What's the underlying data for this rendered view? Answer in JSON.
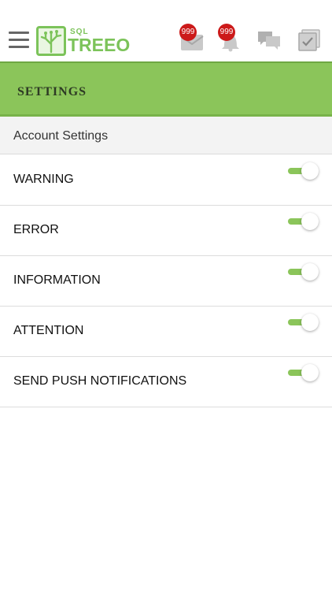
{
  "topbar": {
    "logo": {
      "prefix": "SQL",
      "word": "TREEO"
    },
    "messages_badge": "999",
    "notifications_badge": "999"
  },
  "header": {
    "title": "SETTINGS"
  },
  "section": {
    "title": "Account Settings"
  },
  "settings": [
    {
      "label": "WARNING",
      "enabled": true
    },
    {
      "label": "ERROR",
      "enabled": true
    },
    {
      "label": "INFORMATION",
      "enabled": true
    },
    {
      "label": "ATTENTION",
      "enabled": true
    },
    {
      "label": "SEND PUSH NOTIFICATIONS",
      "enabled": true
    }
  ],
  "colors": {
    "accent": "#8bc55a",
    "badge": "#cc1a1a"
  }
}
